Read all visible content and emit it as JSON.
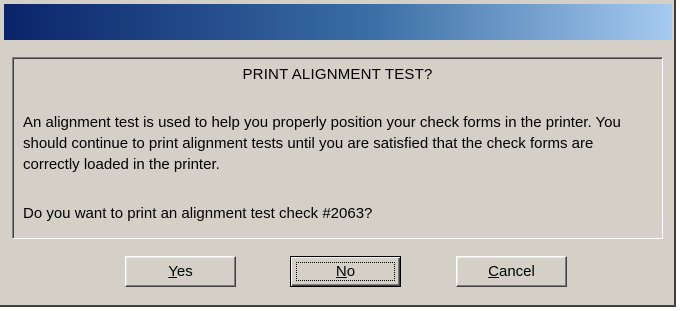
{
  "dialog": {
    "title": "PRINT ALIGNMENT TEST?",
    "body": "An alignment test is used to help you properly position your check forms in the printer.  You should continue to print alignment tests until you are satisfied that the check forms are correctly loaded in the printer.",
    "question": "Do you want to print an alignment test check #2063?"
  },
  "buttons": {
    "yes": {
      "mnemonic": "Y",
      "rest": "es"
    },
    "no": {
      "mnemonic": "N",
      "rest": "o"
    },
    "cancel": {
      "mnemonic": "C",
      "rest": "ancel"
    }
  },
  "colors": {
    "dialog_face": "#d4d0c8",
    "titlebar_start": "#0a246a",
    "titlebar_end": "#a6caf0"
  }
}
